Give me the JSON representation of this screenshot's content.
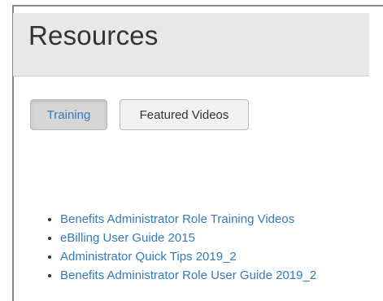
{
  "header": {
    "title": "Resources"
  },
  "tabs": [
    {
      "label": "Training",
      "active": true
    },
    {
      "label": "Featured Videos",
      "active": false
    }
  ],
  "resources": [
    {
      "label": "Benefits Administrator Role Training Videos"
    },
    {
      "label": "eBilling User Guide 2015"
    },
    {
      "label": "Administrator Quick Tips 2019_2"
    },
    {
      "label": "Benefits Administrator Role User Guide 2019_2"
    }
  ],
  "colors": {
    "link": "#337ab7",
    "header_bg": "#e8e8e8",
    "active_tab_bg": "#d6d6d6"
  }
}
